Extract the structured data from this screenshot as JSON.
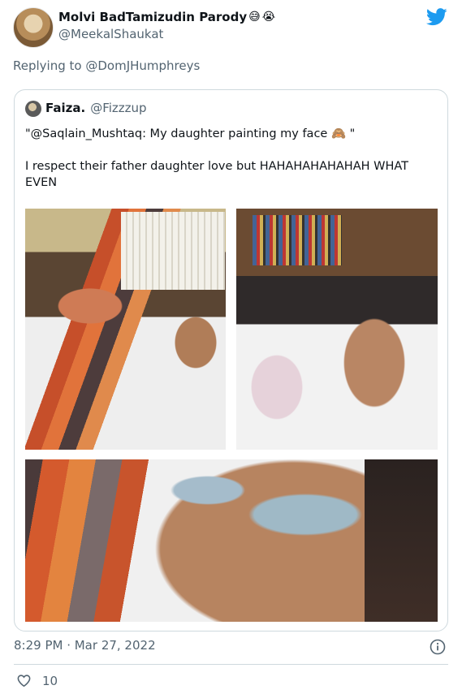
{
  "tweet": {
    "author_name": "Molvi BadTamizudin Parody",
    "author_emojis": [
      "😅",
      "😭"
    ],
    "author_handle": "@MeekalShaukat",
    "reply_prefix": "Replying to",
    "reply_to": "@DomJHumphreys",
    "timestamp": "8:29 PM · Mar 27, 2022",
    "likes": "10"
  },
  "quoted": {
    "author_name": "Faiza.",
    "author_handle": "@Fizzzup",
    "text_line1": "\"@Saqlain_Mushtaq: My daughter painting my face 🙈 \"",
    "text_line2": "I respect their father daughter love but HAHAHAHAHAHAH WHAT EVEN"
  },
  "colors": {
    "twitter_blue": "#1d9bf0",
    "secondary_text": "#536471",
    "border": "#cfd9de"
  },
  "icons": {
    "logo": "twitter-bird-icon",
    "info": "info-icon",
    "like": "heart-icon"
  }
}
